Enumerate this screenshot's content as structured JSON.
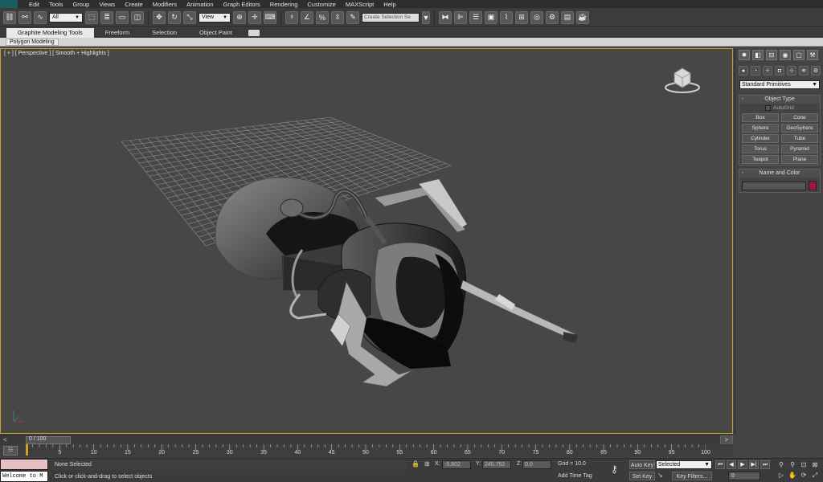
{
  "menu": [
    "Edit",
    "Tools",
    "Group",
    "Views",
    "Create",
    "Modifiers",
    "Animation",
    "Graph Editors",
    "Rendering",
    "Customize",
    "MAXScript",
    "Help"
  ],
  "toolbar": {
    "selection_filter": "All",
    "ref_coord": "View",
    "named_selection_placeholder": "Create Selection Se"
  },
  "ribbon": {
    "tabs": [
      "Graphite Modeling Tools",
      "Freeform",
      "Selection",
      "Object Paint"
    ],
    "active_panel": "Polygon Modeling"
  },
  "viewport": {
    "label": "[ + ] [ Perspective ] [ Smooth + Highlights ]"
  },
  "command_panel": {
    "category": "Standard Primitives",
    "object_type_title": "Object Type",
    "autogrid": "AutoGrid",
    "primitives": [
      "Box",
      "Cone",
      "Sphere",
      "GeoSphere",
      "Cylinder",
      "Tube",
      "Torus",
      "Pyramid",
      "Teapot",
      "Plane"
    ],
    "name_color_title": "Name and Color",
    "object_color": "#a01540"
  },
  "timeline": {
    "frame_display": "0 / 100",
    "left_arrow": "<",
    "right_arrow": ">",
    "ticks": [
      "0",
      "5",
      "10",
      "15",
      "20",
      "25",
      "30",
      "35",
      "40",
      "45",
      "50",
      "55",
      "60",
      "65",
      "70",
      "75",
      "80",
      "85",
      "90",
      "95",
      "100"
    ]
  },
  "status": {
    "maxscript_output": "Welcome to M",
    "selection": "None Selected",
    "prompt": "Click or click-and-drag to select objects",
    "x_label": "X:",
    "x_value": "-5.802",
    "y_label": "Y:",
    "y_value": "245.752",
    "z_label": "Z:",
    "z_value": "0.0",
    "grid": "Grid = 10.0",
    "add_time_tag": "Add Time Tag",
    "auto_key": "Auto Key",
    "set_key": "Set Key",
    "selection_set": "Selected",
    "key_filters": "Key Filters...",
    "current_frame": "0"
  },
  "colors": {
    "viewport_border": "#c9a227",
    "viewport_bg": "#474747"
  }
}
